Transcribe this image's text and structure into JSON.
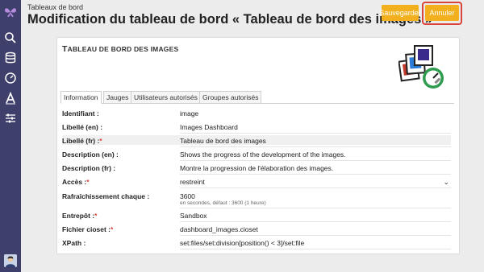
{
  "sidebar": {
    "items": [
      {
        "icon": "butterfly-logo-icon"
      },
      {
        "icon": "search-icon"
      },
      {
        "icon": "database-icon"
      },
      {
        "icon": "gauge-icon"
      },
      {
        "icon": "text-font-icon"
      },
      {
        "icon": "sliders-icon"
      }
    ],
    "avatar_icon": "user-avatar-icon"
  },
  "header": {
    "breadcrumb": "Tableaux de bord",
    "title": "Modification du tableau de bord « Tableau de bord des images »",
    "save_label": "Sauvegarder",
    "cancel_label": "Annuler"
  },
  "card": {
    "title_first": "T",
    "title_rest": "ABLEAU DE BORD DES IMAGES",
    "tabs": [
      "Information",
      "Jauges",
      "Utilisateurs autorisés",
      "Groupes autorisés"
    ],
    "fields": {
      "identifiant": {
        "label": "Identifiant :",
        "value": "image"
      },
      "libelle_en": {
        "label": "Libellé (en) :",
        "value": "Images Dashboard"
      },
      "libelle_fr": {
        "label": "Libellé (fr) :",
        "required": "*",
        "value": "Tableau de bord des images"
      },
      "description_en": {
        "label": "Description (en) :",
        "value": "Shows the progress of the development of the images."
      },
      "description_fr": {
        "label": "Description (fr) :",
        "value": "Montre la progression de l'élaboration des images."
      },
      "acces": {
        "label": "Accès :",
        "required": "*",
        "value": "restreint"
      },
      "rafraichissement": {
        "label": "Rafraîchissement chaque :",
        "value": "3600",
        "hint": "en secondes, défaut : 3600 (1 heure)"
      },
      "entrepot": {
        "label": "Entrepôt :",
        "required": "*",
        "value": "Sandbox"
      },
      "fichier": {
        "label": "Fichier cioset :",
        "required": "*",
        "value": "dashboard_images.cioset"
      },
      "xpath": {
        "label": "XPath :",
        "value": "set:files/set:division[position() < 3]/set:file"
      }
    }
  },
  "colors": {
    "sidebar": "#3f3f6b",
    "accent": "#f2b01e",
    "highlight": "#d9453a"
  }
}
